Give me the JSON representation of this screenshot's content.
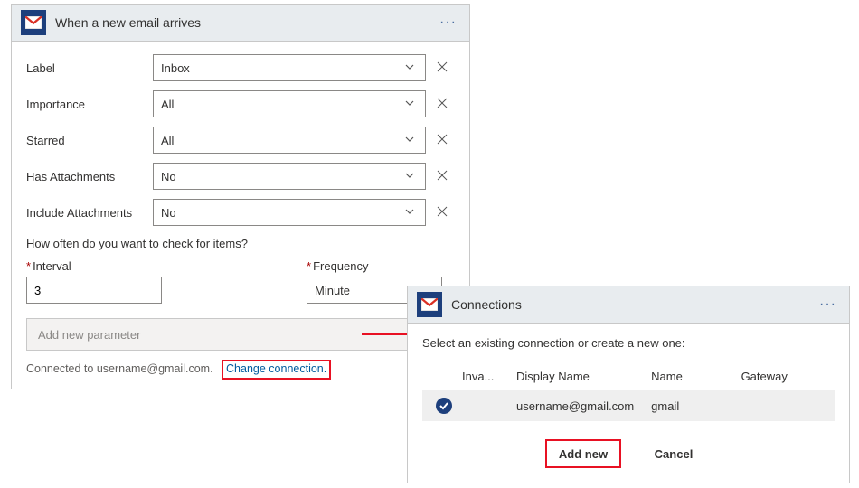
{
  "trigger": {
    "title": "When a new email arrives",
    "fields": [
      {
        "label": "Label",
        "value": "Inbox"
      },
      {
        "label": "Importance",
        "value": "All"
      },
      {
        "label": "Starred",
        "value": "All"
      },
      {
        "label": "Has Attachments",
        "value": "No"
      },
      {
        "label": "Include Attachments",
        "value": "No"
      }
    ],
    "question": "How often do you want to check for items?",
    "interval_label": "Interval",
    "interval_value": "3",
    "frequency_label": "Frequency",
    "frequency_value": "Minute",
    "add_param_placeholder": "Add new parameter",
    "connected_text": "Connected to username@gmail.com.",
    "change_link": "Change connection."
  },
  "connections": {
    "title": "Connections",
    "prompt": "Select an existing connection or create a new one:",
    "headers": {
      "inva": "Inva...",
      "dname": "Display Name",
      "name": "Name",
      "gate": "Gateway"
    },
    "rows": [
      {
        "checked": true,
        "inva": "",
        "dname": "username@gmail.com",
        "name": "gmail",
        "gate": ""
      }
    ],
    "add_label": "Add new",
    "cancel_label": "Cancel"
  }
}
